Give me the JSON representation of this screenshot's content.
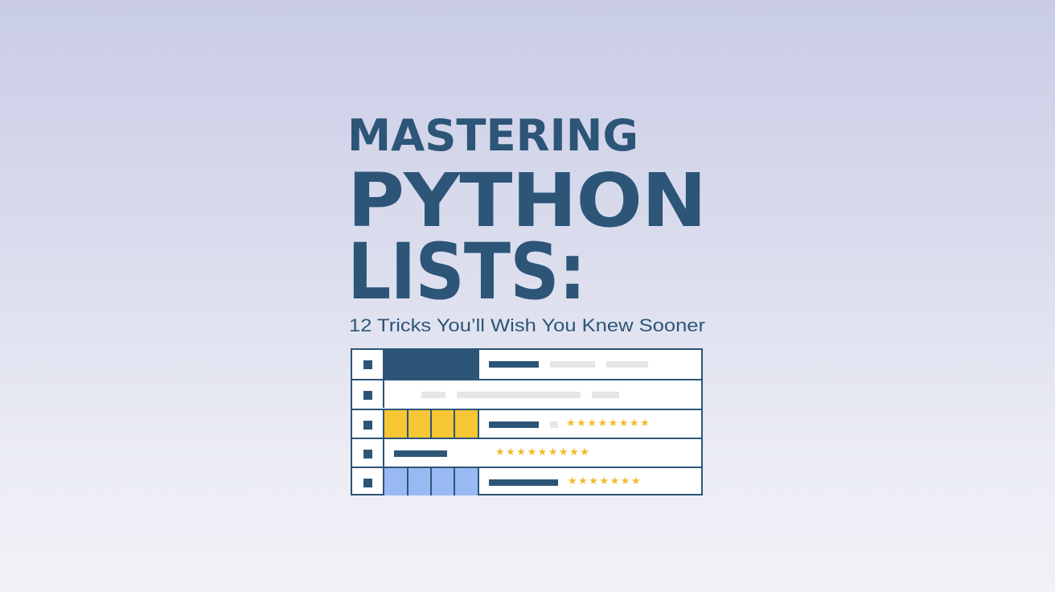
{
  "title": {
    "line1": "MASTERING",
    "line2": "PYTHON",
    "line3": "LISTS:"
  },
  "subtitle": "12 Tricks You’ll Wish You Knew Sooner",
  "illustration": {
    "rows": [
      {
        "block": "navy",
        "rating_stars": 0
      },
      {
        "block": "none",
        "rating_stars": 0
      },
      {
        "block": "gold",
        "rating_stars": 8
      },
      {
        "block": "none",
        "rating_stars": 9
      },
      {
        "block": "sky",
        "rating_stars": 7
      }
    ],
    "star_icon": "star-icon",
    "colors": {
      "navy": "#2c5578",
      "gold": "#f6c634",
      "sky": "#99b9f2",
      "star": "#f0bb2c",
      "placeholder": "#e6e6e9"
    }
  }
}
